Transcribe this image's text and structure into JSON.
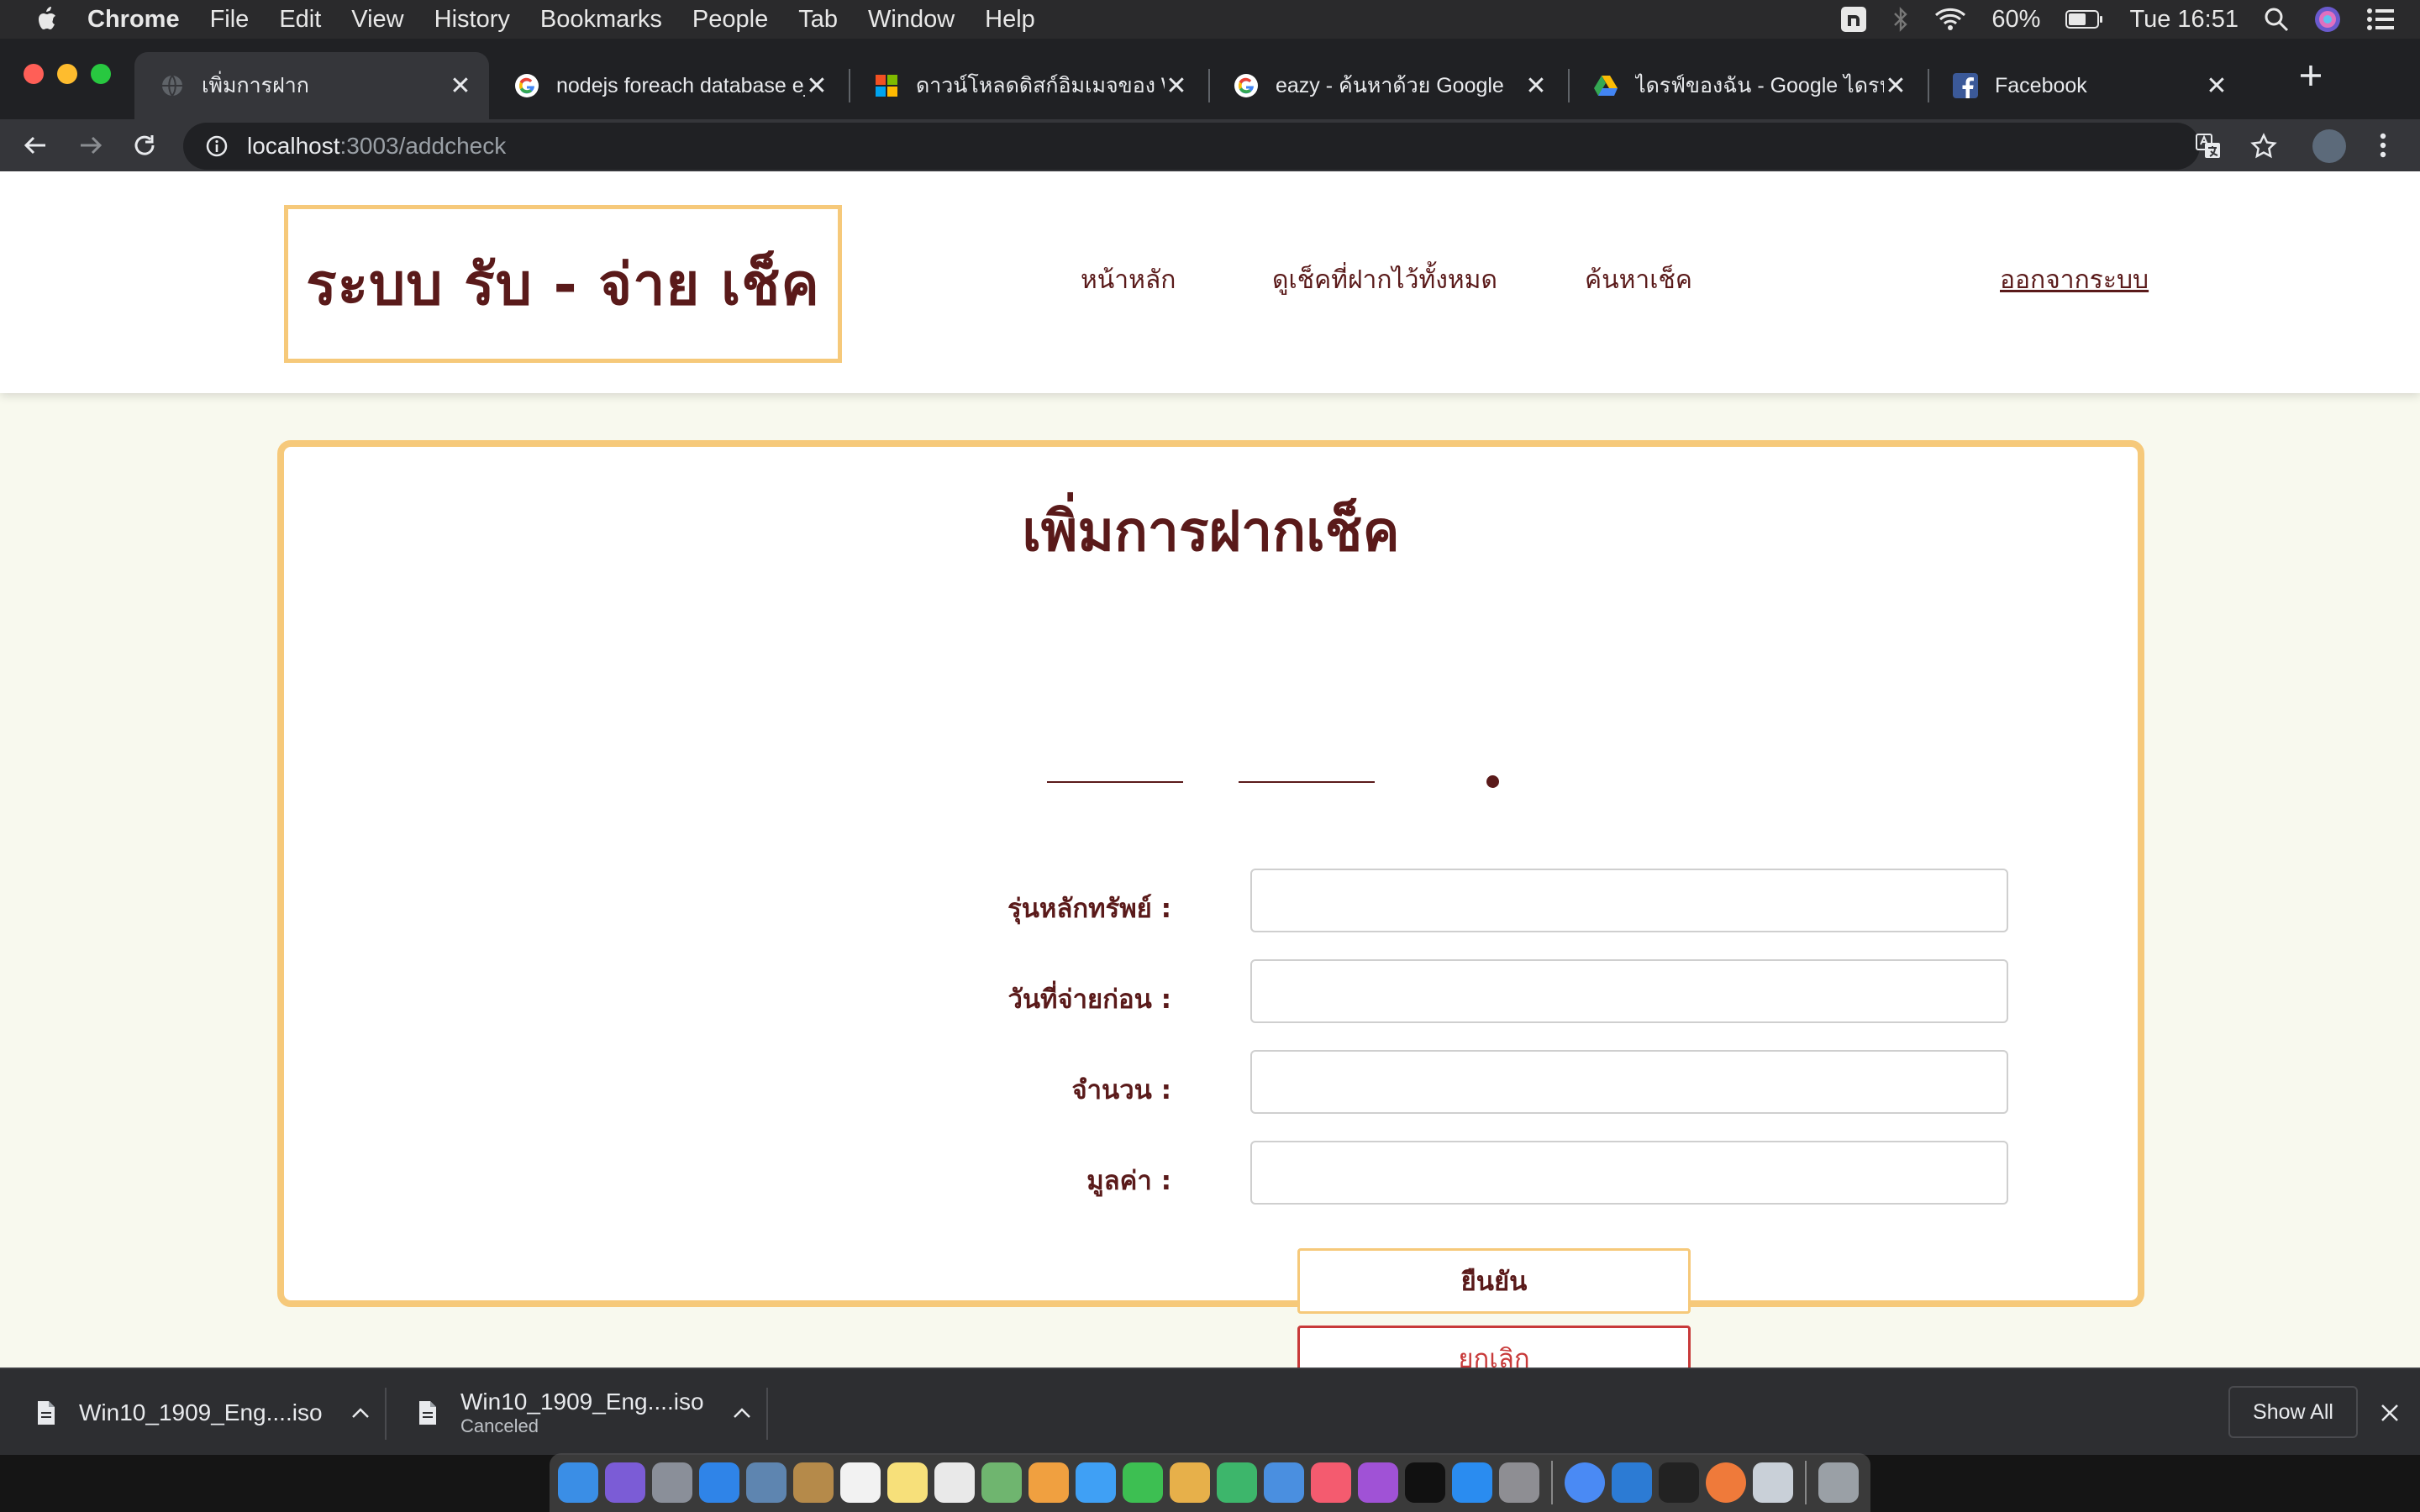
{
  "menubar": {
    "app": "Chrome",
    "items": [
      "File",
      "Edit",
      "View",
      "History",
      "Bookmarks",
      "People",
      "Tab",
      "Window",
      "Help"
    ],
    "battery": "60%",
    "clock": "Tue 16:51"
  },
  "tabs": [
    {
      "title": "เพิ่มการฝาก",
      "favicon": "globe-icon",
      "active": true
    },
    {
      "title": "nodejs foreach database ejs",
      "favicon": "google-icon"
    },
    {
      "title": "ดาวน์โหลดดิสก์อิมเมจของ Windows",
      "favicon": "microsoft-icon"
    },
    {
      "title": "eazy - ค้นหาด้วย Google",
      "favicon": "google-icon"
    },
    {
      "title": "ไดรฟ์ของฉัน - Google ไดรฟ์",
      "favicon": "drive-icon"
    },
    {
      "title": "Facebook",
      "favicon": "facebook-icon"
    }
  ],
  "address": {
    "host": "localhost",
    "path": ":3003/addcheck"
  },
  "site": {
    "logo": "ระบบ รับ - จ่าย เช็ค",
    "nav": {
      "home": "หน้าหลัก",
      "all_checks": "ดูเช็คที่ฝากไว้ทั้งหมด",
      "search": "ค้นหาเช็ค",
      "logout": "ออกจากระบบ"
    }
  },
  "form": {
    "title": "เพิ่มการฝากเช็ค",
    "fields": [
      {
        "label": "รุ่นหลักทรัพย์ :",
        "value": ""
      },
      {
        "label": "วันที่จ่ายก่อน :",
        "value": ""
      },
      {
        "label": "จำนวน :",
        "value": ""
      },
      {
        "label": "มูลค่า :",
        "value": ""
      }
    ],
    "confirm": "ยืนยัน",
    "cancel": "ยกเลิก"
  },
  "downloads": [
    {
      "name": "Win10_1909_Eng....iso",
      "status": ""
    },
    {
      "name": "Win10_1909_Eng....iso",
      "status": "Canceled"
    }
  ],
  "downloads_show_all": "Show All",
  "colors": {
    "accent": "#f6c97a",
    "brand_text": "#5a1a1a",
    "cancel": "#c83a3a",
    "page_bg": "#f8f9ee"
  }
}
